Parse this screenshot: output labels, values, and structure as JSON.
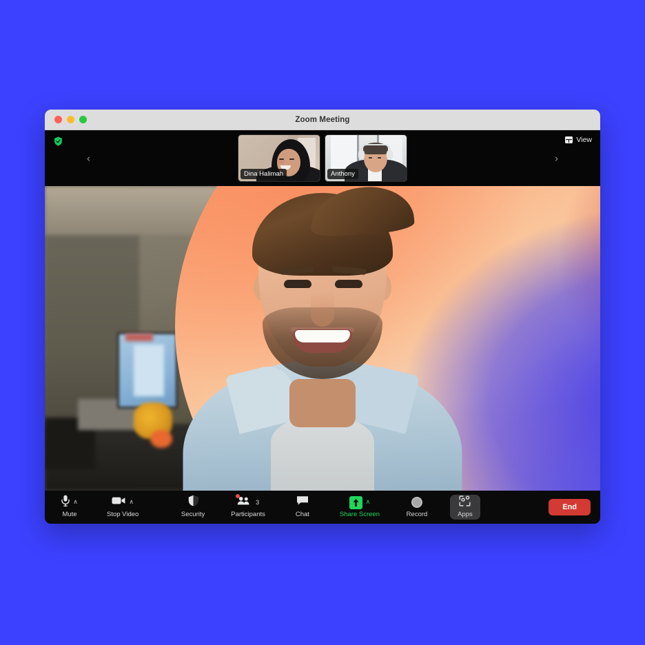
{
  "page": {
    "background_color": "#3B41FE"
  },
  "window": {
    "title": "Zoom Meeting",
    "traffic_lights": [
      {
        "name": "close",
        "color": "#FF5F57"
      },
      {
        "name": "minimize",
        "color": "#FEBC2E"
      },
      {
        "name": "maximize",
        "color": "#28C840"
      }
    ]
  },
  "filmstrip": {
    "encryption_icon": "shield-check-icon",
    "prev_arrow": "‹",
    "next_arrow": "›",
    "view_button": {
      "label": "View",
      "icon": "grid-layout-icon"
    },
    "thumbnails": [
      {
        "name": "Dina Halimah"
      },
      {
        "name": "Anthony"
      }
    ]
  },
  "stage": {
    "active_speaker": "self-video",
    "virtual_background": "gradient-circle"
  },
  "toolbar": {
    "left": [
      {
        "label": "Mute",
        "icon": "microphone-icon",
        "has_caret": true,
        "caret": "∧",
        "active": false
      },
      {
        "label": "Stop Video",
        "icon": "video-camera-icon",
        "has_caret": true,
        "caret": "∧",
        "active": false
      }
    ],
    "center": [
      {
        "label": "Security",
        "icon": "shield-icon",
        "has_caret": false,
        "active": false
      },
      {
        "label": "Participants",
        "icon": "participants-icon",
        "count": "3",
        "badge": true,
        "has_caret": false,
        "active": false
      },
      {
        "label": "Chat",
        "icon": "chat-bubble-icon",
        "has_caret": false,
        "active": false
      },
      {
        "label": "Share Screen",
        "icon": "share-screen-icon",
        "has_caret": true,
        "caret": "∧",
        "accent_color": "#1DD75B",
        "active": false
      },
      {
        "label": "Record",
        "icon": "record-circle-icon",
        "has_caret": false,
        "active": false
      },
      {
        "label": "Apps",
        "icon": "apps-icon",
        "has_caret": false,
        "active": true
      }
    ],
    "end_button": {
      "label": "End",
      "color": "#D33A33"
    }
  }
}
